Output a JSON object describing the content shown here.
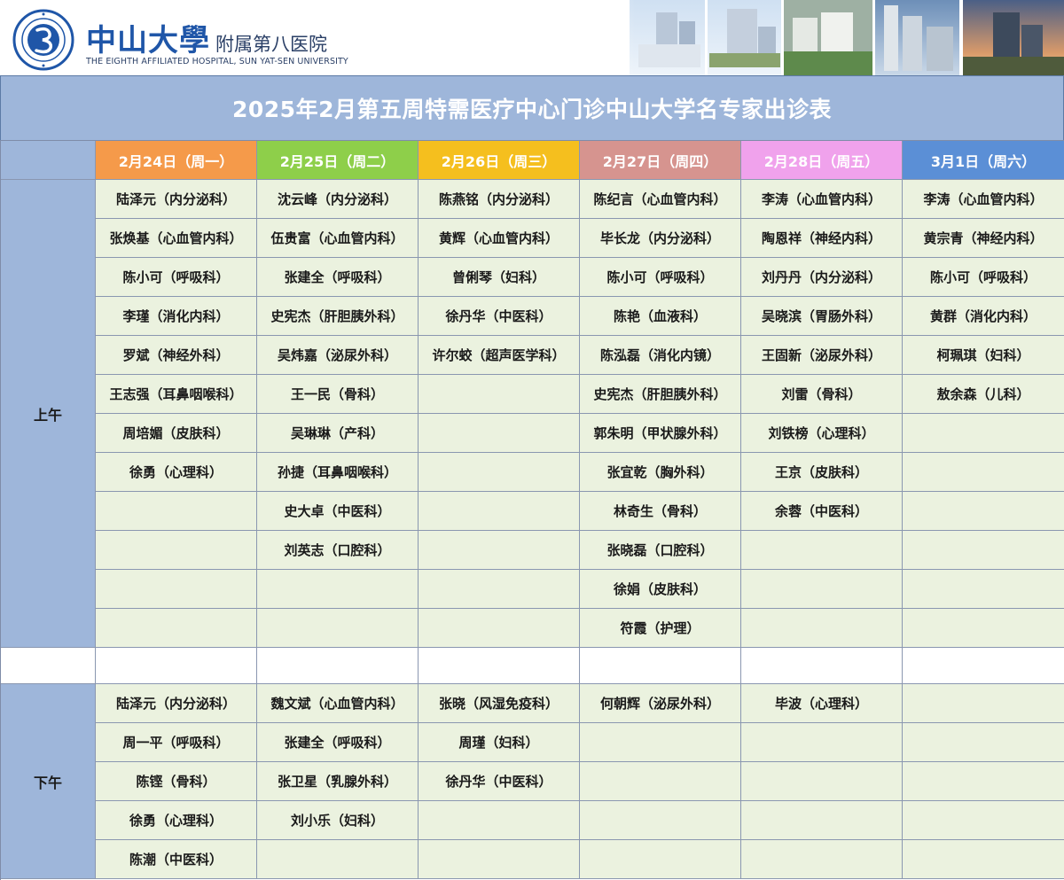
{
  "header": {
    "hospital_cn_main": "中山大學",
    "hospital_cn_sub": "附属第八医院",
    "hospital_en": "THE EIGHTH AFFILIATED HOSPITAL, SUN YAT-SEN UNIVERSITY",
    "logo_icon": "sysu-seal-icon",
    "photos_icon": "hospital-buildings-photo-strip"
  },
  "title": "2025年2月第五周特需医疗中心门诊中山大学名专家出诊表",
  "days": [
    {
      "label": "2月24日（周一）",
      "color": "#f59a4a"
    },
    {
      "label": "2月25日（周二）",
      "color": "#8ecf4a"
    },
    {
      "label": "2月26日（周三）",
      "color": "#f5bf1e"
    },
    {
      "label": "2月27日（周四）",
      "color": "#d6948f"
    },
    {
      "label": "2月28日（周五）",
      "color": "#f0a2ec"
    },
    {
      "label": "3月1日（周六）",
      "color": "#5b8fd6"
    }
  ],
  "morning": {
    "label": "上午",
    "columns": [
      [
        "陆泽元（内分泌科）",
        "张焕基（心血管内科）",
        "陈小可（呼吸科）",
        "李瑾（消化内科）",
        "罗斌（神经外科）",
        "王志强（耳鼻咽喉科）",
        "周培媚（皮肤科）",
        "徐勇（心理科）"
      ],
      [
        "沈云峰（内分泌科）",
        "伍贵富（心血管内科）",
        "张建全（呼吸科）",
        "史宪杰（肝胆胰外科）",
        "吴炜嘉（泌尿外科）",
        "王一民（骨科）",
        "吴琳琳（产科）",
        "孙捷（耳鼻咽喉科）",
        "史大卓（中医科）",
        "刘英志（口腔科）"
      ],
      [
        "陈燕铭（内分泌科）",
        "黄辉（心血管内科）",
        "曾俐琴（妇科）",
        "徐丹华（中医科）",
        "许尔蛟（超声医学科）"
      ],
      [
        "陈纪言（心血管内科）",
        "毕长龙（内分泌科）",
        "陈小可（呼吸科）",
        "陈艳（血液科）",
        "陈泓磊（消化内镜）",
        "史宪杰（肝胆胰外科）",
        "郭朱明（甲状腺外科）",
        "张宜乾（胸外科）",
        "林奇生（骨科）",
        "张晓磊（口腔科）",
        "徐娟（皮肤科）",
        "符霞（护理）"
      ],
      [
        "李涛（心血管内科）",
        "陶恩祥（神经内科）",
        "刘丹丹（内分泌科）",
        "吴晓滨（胃肠外科）",
        "王固新（泌尿外科）",
        "刘雷（骨科）",
        "刘铁榜（心理科）",
        "王京（皮肤科）",
        "余蓉（中医科）"
      ],
      [
        "李涛（心血管内科）",
        "黄宗青（神经内科）",
        "陈小可（呼吸科）",
        "黄群（消化内科）",
        "柯珮琪（妇科）",
        "敖余森（儿科）"
      ]
    ]
  },
  "afternoon": {
    "label": "下午",
    "columns": [
      [
        "陆泽元（内分泌科）",
        "周一平（呼吸科）",
        "陈铿（骨科）",
        "徐勇（心理科）",
        "陈潮（中医科）"
      ],
      [
        "魏文斌（心血管内科）",
        "张建全（呼吸科）",
        "张卫星（乳腺外科）",
        "刘小乐（妇科）"
      ],
      [
        "张晓（风湿免疫科）",
        "周瑾（妇科）",
        "徐丹华（中医科）"
      ],
      [
        "何朝辉（泌尿外科）"
      ],
      [
        "毕波（心理科）"
      ],
      []
    ]
  }
}
